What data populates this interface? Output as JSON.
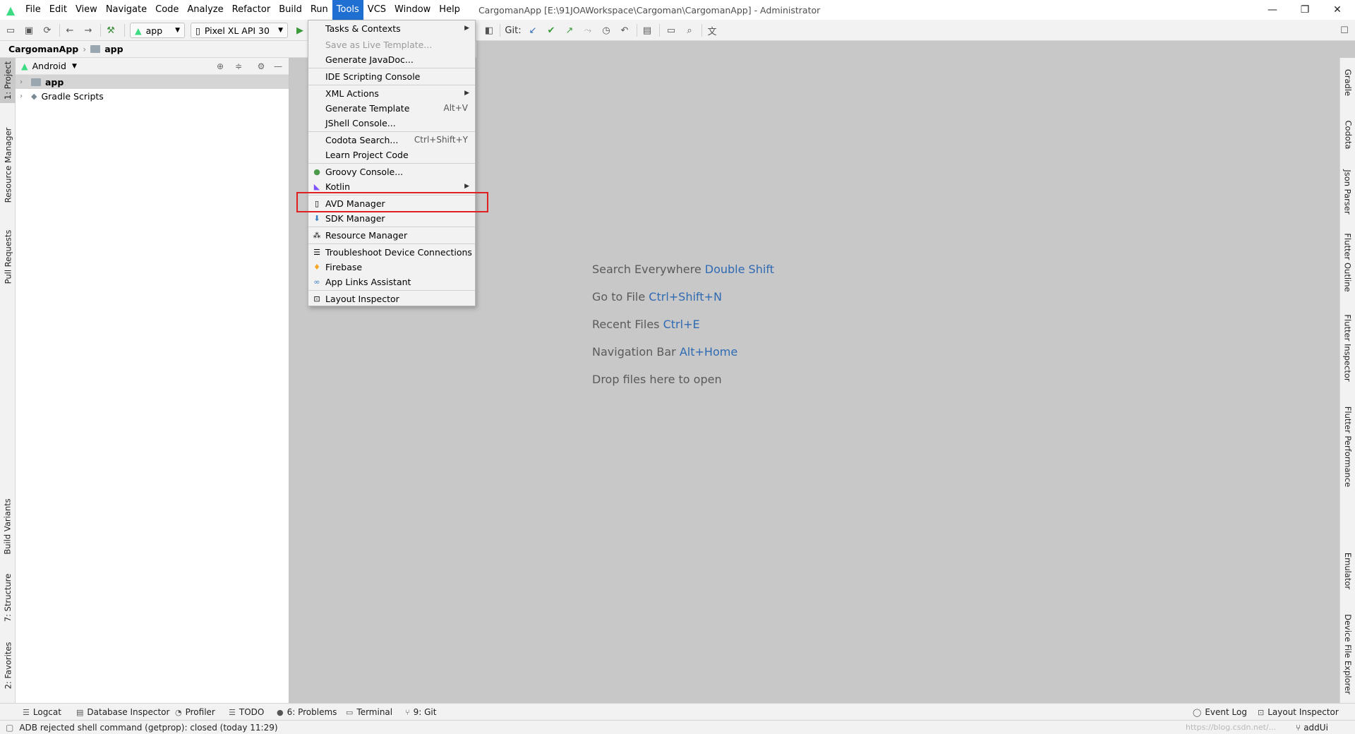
{
  "menubar": {
    "items": [
      "File",
      "Edit",
      "View",
      "Navigate",
      "Code",
      "Analyze",
      "Refactor",
      "Build",
      "Run",
      "Tools",
      "VCS",
      "Window",
      "Help"
    ],
    "active": "Tools",
    "window_title": "CargomanApp [E:\\91JOAWorkspace\\Cargoman\\CargomanApp] - Administrator"
  },
  "toolbar": {
    "run_config": "app",
    "device": "Pixel XL API 30",
    "git_label": "Git:"
  },
  "breadcrumb": {
    "project": "CargomanApp",
    "module": "app"
  },
  "project_panel": {
    "view": "Android",
    "tree": [
      {
        "label": "app",
        "selected": true
      },
      {
        "label": "Gradle Scripts",
        "selected": false
      }
    ]
  },
  "left_stripe": [
    "1: Project",
    "Resource Manager",
    "Pull Requests",
    "Build Variants",
    "7: Structure",
    "2: Favorites"
  ],
  "right_stripe": [
    "Gradle",
    "Codota",
    "Json Parser",
    "Flutter Outline",
    "Flutter Inspector",
    "Flutter Performance",
    "Emulator",
    "Device File Explorer"
  ],
  "editor_hints": [
    {
      "text": "Search Everywhere",
      "key": "Double Shift"
    },
    {
      "text": "Go to File",
      "key": "Ctrl+Shift+N"
    },
    {
      "text": "Recent Files",
      "key": "Ctrl+E"
    },
    {
      "text": "Navigation Bar",
      "key": "Alt+Home"
    },
    {
      "text": "Drop files here to open",
      "key": ""
    }
  ],
  "tools_menu": [
    {
      "label": "Tasks & Contexts",
      "shortcut": "",
      "submenu": true,
      "disabled": false,
      "icon": ""
    },
    {
      "label": "Save as Live Template...",
      "shortcut": "",
      "submenu": false,
      "disabled": true,
      "icon": ""
    },
    {
      "label": "Generate JavaDoc...",
      "shortcut": "",
      "submenu": false,
      "disabled": false,
      "icon": ""
    },
    {
      "label": "IDE Scripting Console",
      "shortcut": "",
      "submenu": false,
      "disabled": false,
      "icon": ""
    },
    {
      "label": "XML Actions",
      "shortcut": "",
      "submenu": true,
      "disabled": false,
      "icon": ""
    },
    {
      "label": "Generate Template",
      "shortcut": "Alt+V",
      "submenu": false,
      "disabled": false,
      "icon": ""
    },
    {
      "label": "JShell Console...",
      "shortcut": "",
      "submenu": false,
      "disabled": false,
      "icon": ""
    },
    {
      "label": "Codota Search...",
      "shortcut": "Ctrl+Shift+Y",
      "submenu": false,
      "disabled": false,
      "icon": ""
    },
    {
      "label": "Learn Project Code",
      "shortcut": "",
      "submenu": false,
      "disabled": false,
      "icon": ""
    },
    {
      "label": "Groovy Console...",
      "shortcut": "",
      "submenu": false,
      "disabled": false,
      "icon": "groovy-icon"
    },
    {
      "label": "Kotlin",
      "shortcut": "",
      "submenu": true,
      "disabled": false,
      "icon": "kotlin-icon"
    },
    {
      "label": "AVD Manager",
      "shortcut": "",
      "submenu": false,
      "disabled": false,
      "icon": "avd-icon"
    },
    {
      "label": "SDK Manager",
      "shortcut": "",
      "submenu": false,
      "disabled": false,
      "icon": "sdk-icon"
    },
    {
      "label": "Resource Manager",
      "shortcut": "",
      "submenu": false,
      "disabled": false,
      "icon": "resource-icon"
    },
    {
      "label": "Troubleshoot Device Connections",
      "shortcut": "",
      "submenu": false,
      "disabled": false,
      "icon": "list-icon"
    },
    {
      "label": "Firebase",
      "shortcut": "",
      "submenu": false,
      "disabled": false,
      "icon": "firebase-icon"
    },
    {
      "label": "App Links Assistant",
      "shortcut": "",
      "submenu": false,
      "disabled": false,
      "icon": "link-icon"
    },
    {
      "label": "Layout Inspector",
      "shortcut": "",
      "submenu": false,
      "disabled": false,
      "icon": "inspector-icon"
    }
  ],
  "bottom_bar": {
    "left": [
      "Logcat",
      "Database Inspector",
      "Profiler",
      "TODO",
      "6: Problems",
      "Terminal",
      "9: Git"
    ],
    "right": [
      "Event Log",
      "Layout Inspector"
    ]
  },
  "status": {
    "message": "ADB rejected shell command (getprop): closed (today 11:29)",
    "branch": "addUi",
    "watermark": "https://blog.csdn.net/..."
  },
  "colors": {
    "menu_active": "#1e6fd1",
    "highlight": "#e02020",
    "hint_key": "#2f6ab3"
  }
}
